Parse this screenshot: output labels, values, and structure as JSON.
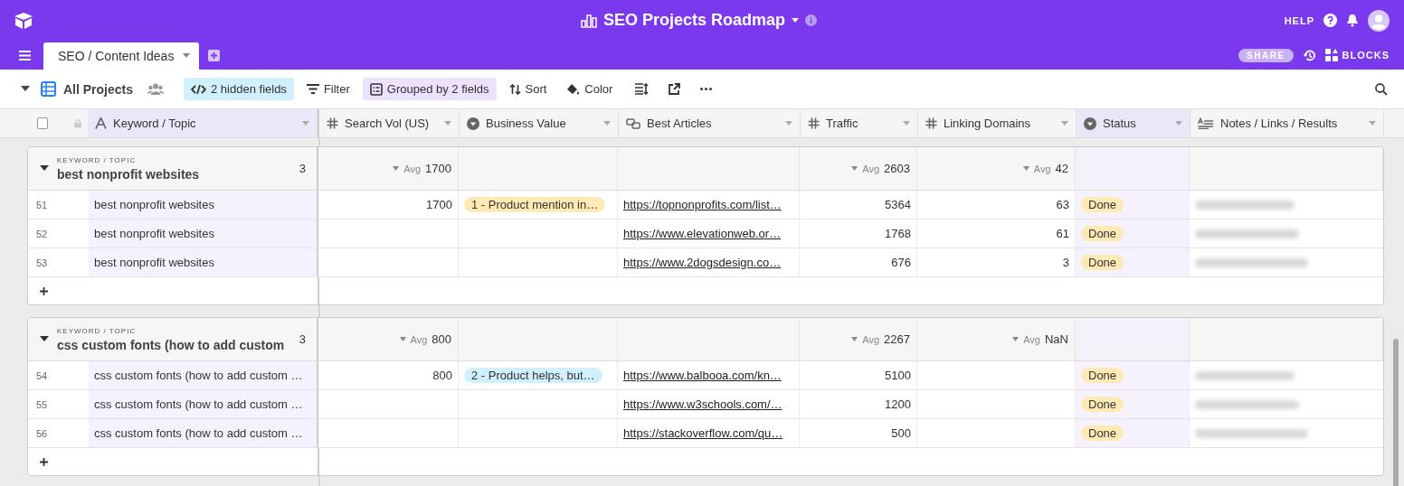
{
  "base": {
    "title": "SEO Projects Roadmap"
  },
  "top_right": {
    "help": "HELP",
    "share": "SHARE",
    "blocks": "BLOCKS"
  },
  "tabs": [
    {
      "label": "SEO / Content Ideas",
      "selected": true
    }
  ],
  "toolbar": {
    "view": "All Projects",
    "hidden_fields": "2 hidden fields",
    "filter": "Filter",
    "grouped": "Grouped by 2 fields",
    "sort": "Sort",
    "color_button": "Color"
  },
  "select_all": {
    "checked": false
  },
  "columns": [
    {
      "label": "Keyword / Topic",
      "kind": "text",
      "highlighted": true
    },
    {
      "label": "Search Vol (US)",
      "kind": "number",
      "highlighted": false
    },
    {
      "label": "Business Value",
      "kind": "select",
      "highlighted": false
    },
    {
      "label": "Best Articles",
      "kind": "link",
      "highlighted": false
    },
    {
      "label": "Traffic",
      "kind": "number",
      "highlighted": false
    },
    {
      "label": "Linking Domains",
      "kind": "number",
      "highlighted": false
    },
    {
      "label": "Status",
      "kind": "select",
      "highlighted": true
    },
    {
      "label": "Notes / Links / Results",
      "kind": "longtext",
      "highlighted": false
    }
  ],
  "groups": [
    {
      "field": "KEYWORD / TOPIC",
      "title": "best nonprofit websites",
      "count": "3",
      "summaries": {
        "search_vol": {
          "label": "Avg",
          "value": "1700"
        },
        "traffic": {
          "label": "Avg",
          "value": "2603"
        },
        "linking_domains": {
          "label": "Avg",
          "value": "42"
        }
      },
      "records": [
        {
          "number": "51",
          "keyword": "best nonprofit websites",
          "search_vol": "1700",
          "business_value": {
            "label": "1 - Product mention in…",
            "color": "#ffeab6"
          },
          "article": "https://topnonprofits.com/list…",
          "traffic": "5364",
          "linking_domains": "63",
          "status": {
            "label": "Done",
            "color": "#ffeab6"
          },
          "notes_blurred": true
        },
        {
          "number": "52",
          "keyword": "best nonprofit websites",
          "article": "https://www.elevationweb.or…",
          "traffic": "1768",
          "linking_domains": "61",
          "status": {
            "label": "Done",
            "color": "#ffeab6"
          },
          "notes_blurred": true
        },
        {
          "number": "53",
          "keyword": "best nonprofit websites",
          "article": "https://www.2dogsdesign.co…",
          "traffic": "676",
          "linking_domains": "3",
          "status": {
            "label": "Done",
            "color": "#ffeab6"
          },
          "notes_blurred": true
        }
      ]
    },
    {
      "field": "KEYWORD / TOPIC",
      "title": "css custom fonts (how to add custom",
      "count": "3",
      "summaries": {
        "search_vol": {
          "label": "Avg",
          "value": "800"
        },
        "traffic": {
          "label": "Avg",
          "value": "2267"
        },
        "linking_domains": {
          "label": "Avg",
          "value": "NaN"
        }
      },
      "records": [
        {
          "number": "54",
          "keyword": "css custom fonts (how to add custom …",
          "search_vol": "800",
          "business_value": {
            "label": "2 - Product helps, but…",
            "color": "#d0f0fd"
          },
          "article": "https://www.balbooa.com/kn…",
          "traffic": "5100",
          "status": {
            "label": "Done",
            "color": "#ffeab6"
          },
          "notes_blurred": true
        },
        {
          "number": "55",
          "keyword": "css custom fonts (how to add custom …",
          "article": "https://www.w3schools.com/…",
          "traffic": "1200",
          "status": {
            "label": "Done",
            "color": "#ffeab6"
          },
          "notes_blurred": true
        },
        {
          "number": "56",
          "keyword": "css custom fonts (how to add custom …",
          "article": "https://stackoverflow.com/qu…",
          "traffic": "500",
          "status": {
            "label": "Done",
            "color": "#ffeab6"
          },
          "notes_blurred": true
        }
      ]
    }
  ]
}
